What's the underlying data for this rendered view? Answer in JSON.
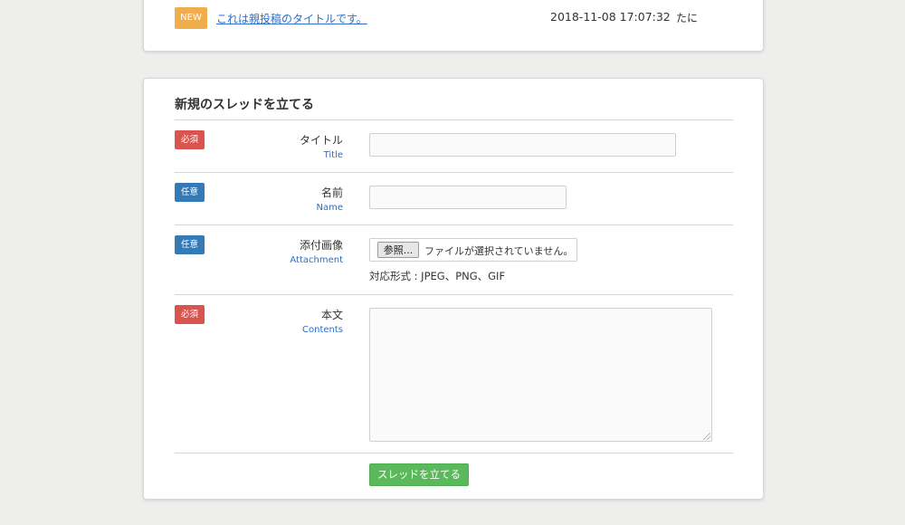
{
  "recent_post": {
    "badge": "NEW",
    "title": "これは親投稿のタイトルです。",
    "datetime": "2018-11-08 17:07:32",
    "author": "たに"
  },
  "form": {
    "heading": "新規のスレッドを立てる",
    "fields": {
      "title": {
        "badge": "必須",
        "label": "タイトル",
        "sub": "Title",
        "value": ""
      },
      "name": {
        "badge": "任意",
        "label": "名前",
        "sub": "Name",
        "value": ""
      },
      "attachment": {
        "badge": "任意",
        "label": "添付画像",
        "sub": "Attachment",
        "browse_label": "参照...",
        "status": "ファイルが選択されていません。",
        "formats_note": "対応形式 : JPEG、PNG、GIF"
      },
      "contents": {
        "badge": "必須",
        "label": "本文",
        "sub": "Contents",
        "value": ""
      }
    },
    "submit_label": "スレッドを立てる"
  },
  "colors": {
    "background": "#eeeeec",
    "new_badge": "#f0ad4e",
    "required_badge": "#d9534f",
    "optional_badge": "#337ab7",
    "link": "#2a6fc9",
    "submit": "#5cb85c"
  }
}
